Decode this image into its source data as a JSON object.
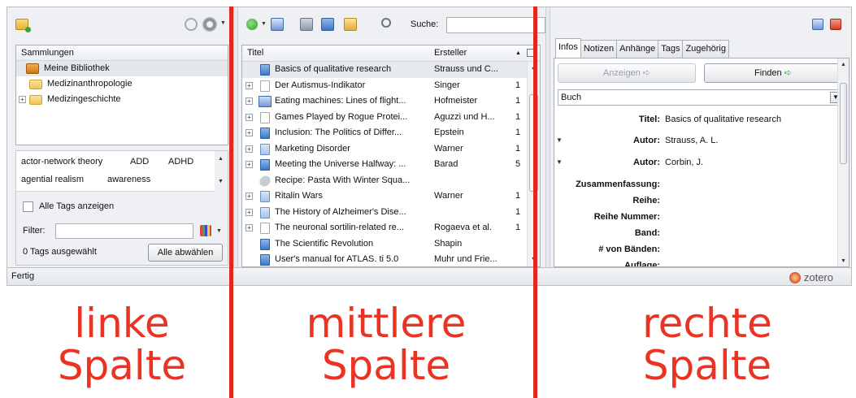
{
  "left": {
    "collections_header": "Sammlungen",
    "collections": [
      {
        "label": "Meine Bibliothek",
        "selected": true
      },
      {
        "label": "Medizinanthropologie",
        "expander": ""
      },
      {
        "label": "Medizingeschichte",
        "expander": "+"
      }
    ],
    "tags": [
      {
        "label": "actor-network theory"
      },
      {
        "label": "ADD"
      },
      {
        "label": "ADHD"
      },
      {
        "label": "agential realism"
      },
      {
        "label": "awareness"
      }
    ],
    "show_all_tags": "Alle Tags anzeigen",
    "filter_label": "Filter:",
    "tags_selected": "0 Tags ausgewählt",
    "deselect_all": "Alle abwählen"
  },
  "middle": {
    "search_label": "Suche:",
    "columns": {
      "title": "Titel",
      "creator": "Ersteller",
      "sort": "▲"
    },
    "rows": [
      {
        "expander": "",
        "icon": "book-icon",
        "title": "Basics of qualitative research",
        "creator": "Strauss und C...",
        "count": "",
        "selected": true
      },
      {
        "expander": "+",
        "icon": "document-icon",
        "title": "Der Autismus-Indikator",
        "creator": "Singer",
        "count": "1"
      },
      {
        "expander": "+",
        "icon": "book-open-icon",
        "title": "Eating machines: Lines of flight...",
        "creator": "Hofmeister",
        "count": "1"
      },
      {
        "expander": "+",
        "icon": "document-icon",
        "title": "Games Played by Rogue Protei...",
        "creator": "Aguzzi und H...",
        "count": "1"
      },
      {
        "expander": "+",
        "icon": "book-icon",
        "title": "Inclusion: The Politics of Differ...",
        "creator": "Epstein",
        "count": "1"
      },
      {
        "expander": "+",
        "icon": "journal-icon",
        "title": "Marketing Disorder",
        "creator": "Warner",
        "count": "1"
      },
      {
        "expander": "+",
        "icon": "book-icon",
        "title": "Meeting the Universe Halfway: ...",
        "creator": "Barad",
        "count": "5"
      },
      {
        "expander": "",
        "icon": "recipe-icon",
        "title": "Recipe: Pasta With Winter Squa...",
        "creator": "",
        "count": ""
      },
      {
        "expander": "+",
        "icon": "journal-icon",
        "title": "Ritalin Wars",
        "creator": "Warner",
        "count": "1"
      },
      {
        "expander": "+",
        "icon": "journal-icon",
        "title": "The History of Alzheimer's Dise...",
        "creator": "",
        "count": "1"
      },
      {
        "expander": "+",
        "icon": "document-icon",
        "title": "The neuronal sortilin-related re...",
        "creator": "Rogaeva et al.",
        "count": "1"
      },
      {
        "expander": "",
        "icon": "book-icon",
        "title": "The Scientific Revolution",
        "creator": "Shapin",
        "count": ""
      },
      {
        "expander": "",
        "icon": "book-icon",
        "title": "User's manual for ATLAS. ti 5.0",
        "creator": "Muhr und Frie...",
        "count": ""
      }
    ]
  },
  "right": {
    "tabs": [
      "Infos",
      "Notizen",
      "Anhänge",
      "Tags",
      "Zugehörig"
    ],
    "view_button": "Anzeigen ➪",
    "find_button": "Finden",
    "find_arrow": "➪",
    "item_type": "Buch",
    "fields": [
      {
        "label": "Titel:",
        "value": "Basics of qualitative research",
        "toggle": ""
      },
      {
        "label": "Autor:",
        "value": "Strauss,   A. L.",
        "toggle": "▼"
      },
      {
        "label": "Autor:",
        "value": "Corbin,   J.",
        "toggle": "▼"
      },
      {
        "label": "Zusammenfassung:",
        "value": "",
        "toggle": ""
      },
      {
        "label": "Reihe:",
        "value": "",
        "toggle": ""
      },
      {
        "label": "Reihe Nummer:",
        "value": "",
        "toggle": ""
      },
      {
        "label": "Band:",
        "value": "",
        "toggle": ""
      },
      {
        "label": "# von Bänden:",
        "value": "",
        "toggle": ""
      },
      {
        "label": "Auflage:",
        "value": "",
        "toggle": ""
      }
    ]
  },
  "status": {
    "text": "Fertig",
    "brand": "zotero"
  },
  "captions": {
    "left": [
      "linke",
      "Spalte"
    ],
    "middle": [
      "mittlere",
      "Spalte"
    ],
    "right": [
      "rechte",
      "Spalte"
    ]
  },
  "colors": {
    "divider": "#e3281b",
    "caption": "#ea3323",
    "accent_green": "#39a830"
  }
}
